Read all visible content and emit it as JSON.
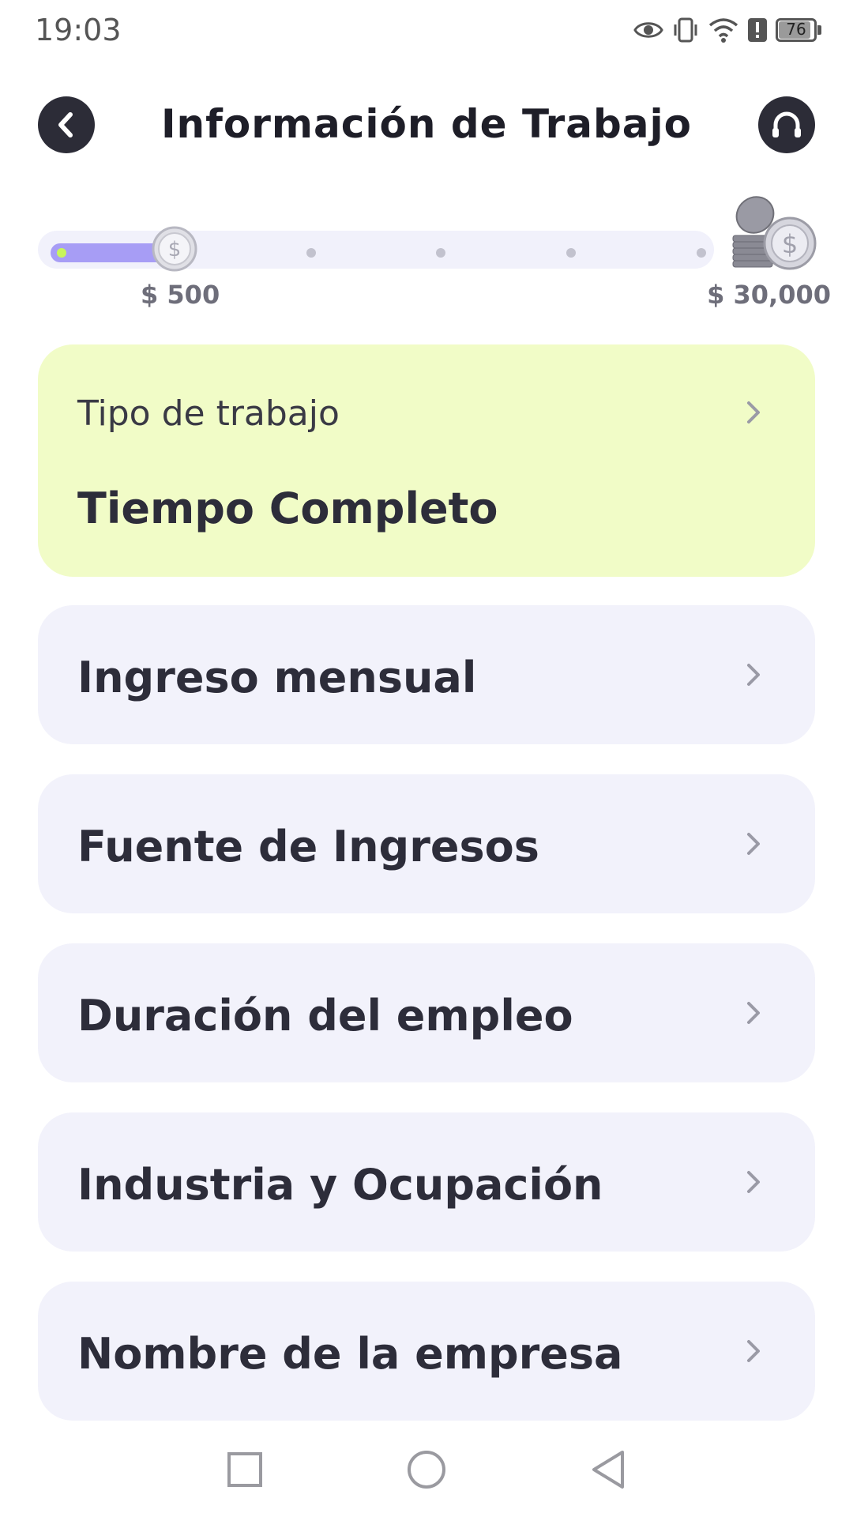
{
  "status": {
    "time": "19:03",
    "battery": "76",
    "icons": [
      "eye-icon",
      "vibrate-icon",
      "wifi-icon",
      "alert-icon",
      "battery-icon"
    ]
  },
  "header": {
    "title": "Información de Trabajo",
    "back_icon": "chevron-left-icon",
    "support_icon": "headset-icon"
  },
  "progress": {
    "min_label": "$ 500",
    "max_label": "$ 30,000",
    "current_fraction": 0.19,
    "steps": 6,
    "fill_color": "#a79df5",
    "reward_icon": "coins-icon"
  },
  "job_type": {
    "label": "Tipo de trabajo",
    "value": "Tiempo Completo",
    "color": "#f1fcc7"
  },
  "items": [
    {
      "label": "Ingreso mensual"
    },
    {
      "label": "Fuente de Ingresos"
    },
    {
      "label": "Duración del empleo"
    },
    {
      "label": "Industria y Ocupación"
    },
    {
      "label": "Nombre de la empresa"
    }
  ],
  "nav": [
    "recent-apps-icon",
    "home-icon",
    "back-icon"
  ],
  "colors": {
    "accent_dark": "#2c2c37",
    "card_bg": "#f2f2fb"
  }
}
